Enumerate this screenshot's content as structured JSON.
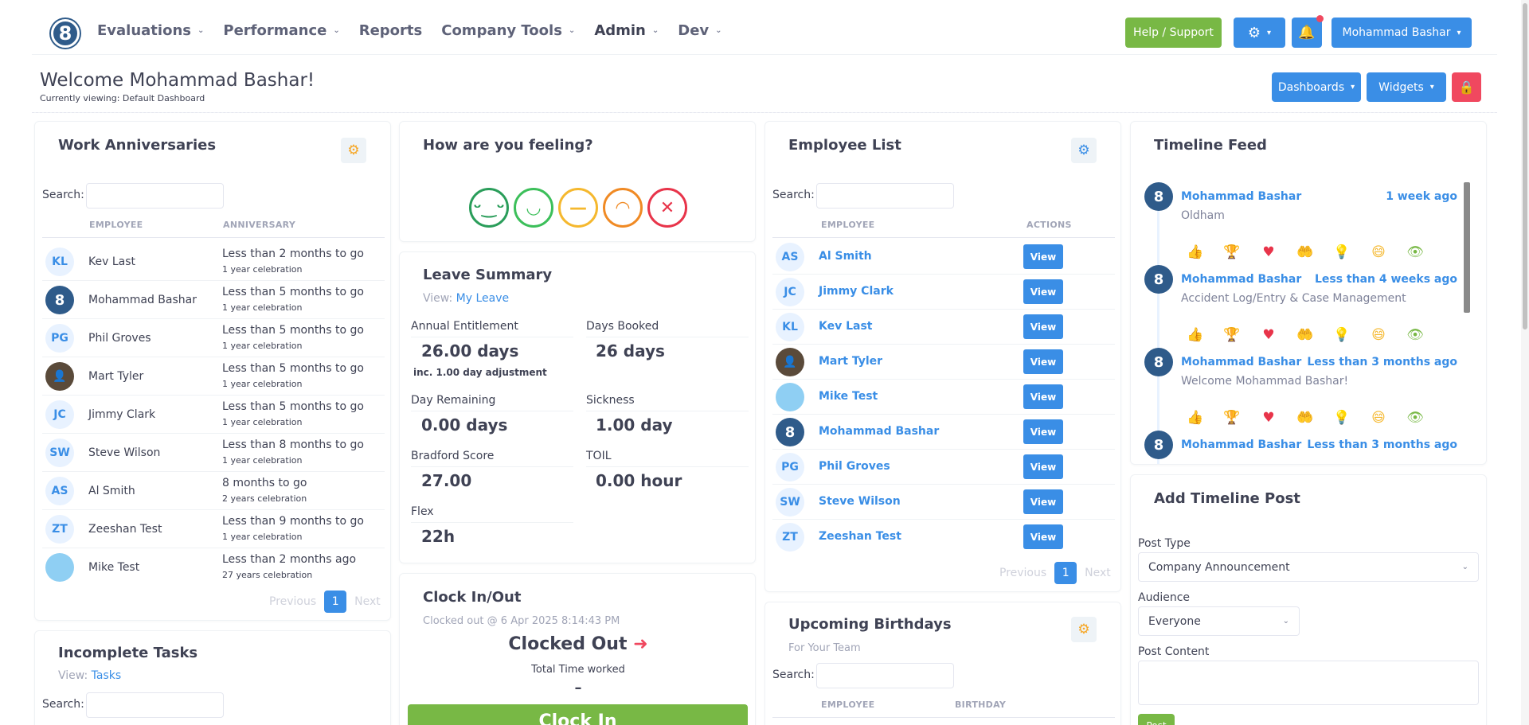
{
  "nav": {
    "logo_text": "8",
    "items": [
      {
        "label": "Evaluations",
        "has_menu": true
      },
      {
        "label": "Performance",
        "has_menu": true
      },
      {
        "label": "Reports",
        "has_menu": false
      },
      {
        "label": "Company Tools",
        "has_menu": true
      },
      {
        "label": "Admin",
        "has_menu": true
      },
      {
        "label": "Dev",
        "has_menu": true
      }
    ],
    "help_label": "Help / Support",
    "user_label": "Mohammad Bashar"
  },
  "header": {
    "welcome": "Welcome Mohammad Bashar!",
    "viewing": "Currently viewing: Default Dashboard",
    "dashboards_label": "Dashboards",
    "widgets_label": "Widgets"
  },
  "anniversaries": {
    "title": "Work Anniversaries",
    "search_label": "Search:",
    "col_employee": "EMPLOYEE",
    "col_anniversary": "ANNIVERSARY",
    "rows": [
      {
        "initials": "KL",
        "name": "Kev Last",
        "when": "Less than 2 months to go",
        "celebration": "1 year celebration"
      },
      {
        "initials": "8",
        "name": "Mohammad Bashar",
        "when": "Less than 5 months to go",
        "celebration": "1 year celebration"
      },
      {
        "initials": "PG",
        "name": "Phil Groves",
        "when": "Less than 5 months to go",
        "celebration": "1 year celebration"
      },
      {
        "initials": "",
        "name": "Mart Tyler",
        "when": "Less than 5 months to go",
        "celebration": "1 year celebration"
      },
      {
        "initials": "JC",
        "name": "Jimmy Clark",
        "when": "Less than 5 months to go",
        "celebration": "1 year celebration"
      },
      {
        "initials": "SW",
        "name": "Steve Wilson",
        "when": "Less than 8 months to go",
        "celebration": "1 year celebration"
      },
      {
        "initials": "AS",
        "name": "Al Smith",
        "when": "8 months to go",
        "celebration": "2 years celebration"
      },
      {
        "initials": "ZT",
        "name": "Zeeshan Test",
        "when": "Less than 9 months to go",
        "celebration": "1 year celebration"
      },
      {
        "initials": "",
        "name": "Mike Test",
        "when": "Less than 2 months ago",
        "celebration": "27 years celebration"
      }
    ],
    "prev": "Previous",
    "page": "1",
    "next": "Next"
  },
  "tasks": {
    "title": "Incomplete Tasks",
    "view_label": "View:",
    "view_link": "Tasks",
    "search_label": "Search:"
  },
  "feeling": {
    "title": "How are you feeling?",
    "faces": [
      "very-happy",
      "happy",
      "neutral",
      "sad",
      "very-sad"
    ]
  },
  "leave": {
    "title": "Leave Summary",
    "view_label": "View:",
    "view_link": "My Leave",
    "items": [
      {
        "label": "Annual Entitlement",
        "value": "26.00 days",
        "note": "inc. 1.00 day adjustment"
      },
      {
        "label": "Days Booked",
        "value": "26 days",
        "note": ""
      },
      {
        "label": "Day Remaining",
        "value": "0.00 days",
        "note": ""
      },
      {
        "label": "Sickness",
        "value": "1.00 day",
        "note": ""
      },
      {
        "label": "Bradford Score",
        "value": "27.00",
        "note": ""
      },
      {
        "label": "TOIL",
        "value": "0.00 hour",
        "note": ""
      },
      {
        "label": "Flex",
        "value": "22h",
        "note": ""
      }
    ]
  },
  "clock": {
    "title": "Clock In/Out",
    "status_line": "Clocked out @ 6 Apr 2025 8:14:43 PM",
    "state": "Clocked Out",
    "total_label": "Total Time worked",
    "total_value": "–",
    "button": "Clock In"
  },
  "employees": {
    "title": "Employee List",
    "search_label": "Search:",
    "col_employee": "EMPLOYEE",
    "col_actions": "ACTIONS",
    "view_label": "View",
    "rows": [
      {
        "initials": "AS",
        "name": "Al Smith"
      },
      {
        "initials": "JC",
        "name": "Jimmy Clark"
      },
      {
        "initials": "KL",
        "name": "Kev Last"
      },
      {
        "initials": "",
        "name": "Mart Tyler"
      },
      {
        "initials": "",
        "name": "Mike Test"
      },
      {
        "initials": "8",
        "name": "Mohammad Bashar"
      },
      {
        "initials": "PG",
        "name": "Phil Groves"
      },
      {
        "initials": "SW",
        "name": "Steve Wilson"
      },
      {
        "initials": "ZT",
        "name": "Zeeshan Test"
      }
    ],
    "prev": "Previous",
    "page": "1",
    "next": "Next"
  },
  "birthdays": {
    "title": "Upcoming Birthdays",
    "subtitle": "For Your Team",
    "search_label": "Search:",
    "col_employee": "EMPLOYEE",
    "col_birthday": "BIRTHDAY"
  },
  "timeline": {
    "title": "Timeline Feed",
    "posts": [
      {
        "author": "Mohammad Bashar",
        "time": "1 week ago",
        "text": "Oldham"
      },
      {
        "author": "Mohammad Bashar",
        "time": "Less than 4 weeks ago",
        "text": "Accident Log/Entry & Case Management"
      },
      {
        "author": "Mohammad Bashar",
        "time": "Less than 3 months ago",
        "text": "Welcome Mohammad Bashar!"
      },
      {
        "author": "Mohammad Bashar",
        "time": "Less than 3 months ago",
        "text": ""
      }
    ],
    "reactions": [
      "👍",
      "🏆",
      "♥",
      "🤲",
      "💡",
      "😄",
      "👁"
    ]
  },
  "add_post": {
    "title": "Add Timeline Post",
    "type_label": "Post Type",
    "type_value": "Company Announcement",
    "audience_label": "Audience",
    "audience_value": "Everyone",
    "content_label": "Post Content",
    "button": "Post"
  }
}
